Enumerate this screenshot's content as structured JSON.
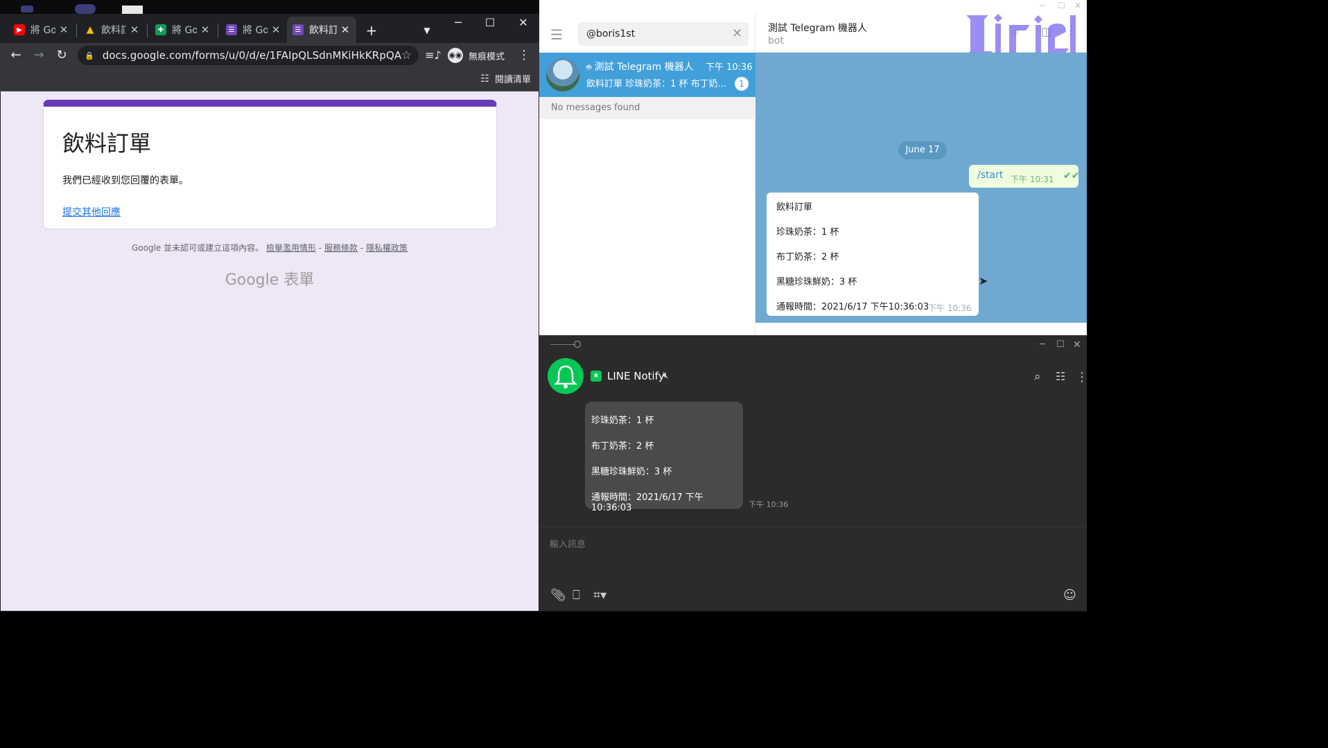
{
  "chrome": {
    "tabs": [
      {
        "label": "將 Go",
        "icon": "youtube-icon",
        "color": "#ff0000"
      },
      {
        "label": "飲料訂",
        "icon": "google-drive-icon",
        "color": "#1fa463"
      },
      {
        "label": "將 Go",
        "icon": "google-sheets-icon",
        "color": "#0f9d58"
      },
      {
        "label": "將 Go",
        "icon": "google-forms-icon",
        "color": "#7248b9"
      },
      {
        "label": "飲料訂",
        "icon": "google-forms-icon",
        "color": "#7248b9"
      }
    ],
    "url": "docs.google.com/forms/u/0/d/e/1FAIpQLSdnMKiHkKRpQA...",
    "incognito_label": "無痕模式",
    "reading_list_label": "閱讀清單",
    "form": {
      "title": "飲料訂單",
      "message": "我們已經收到您回覆的表單。",
      "link": "提交其他回應",
      "accent": "#673ab7"
    },
    "footer": {
      "note": "Google 並未認可或建立這項內容。",
      "links": [
        "檢舉濫用情形",
        "服務條款",
        "隱私權政策"
      ],
      "sep": "-",
      "logo": "Google 表單"
    }
  },
  "telegram": {
    "search_value": "@boris1st",
    "chat": {
      "name": "測試 Telegram 機器人",
      "time": "下午 10:36",
      "preview": "飲料訂單 珍珠奶茶：1 杯 布丁奶...",
      "unread": "1"
    },
    "no_messages": "No messages found",
    "header": {
      "title": "測試 Telegram 機器人",
      "subtitle": "bot"
    },
    "watermark": "Biriel",
    "date_pill": "June 17",
    "outgoing": {
      "text": "/start",
      "time": "下午 10:31"
    },
    "incoming": {
      "lines": [
        "飲料訂單",
        "珍珠奶茶：1 杯",
        "布丁奶茶：2 杯",
        "黑糖珍珠鮮奶：3 杯",
        "通報時間：2021/6/17 下午10:36:03"
      ],
      "time": "下午 10:36"
    },
    "accent": "#419fd9",
    "chat_bg": "#6fa9d2"
  },
  "line": {
    "name": "LINE Notify",
    "message_lines": [
      "珍珠奶茶：1 杯",
      "布丁奶茶：2 杯",
      "黑糖珍珠鮮奶：3 杯",
      "通報時間：2021/6/17 下午10:36:03"
    ],
    "time": "下午 10:36",
    "input_placeholder": "輸入訊息",
    "accent": "#06c755"
  }
}
